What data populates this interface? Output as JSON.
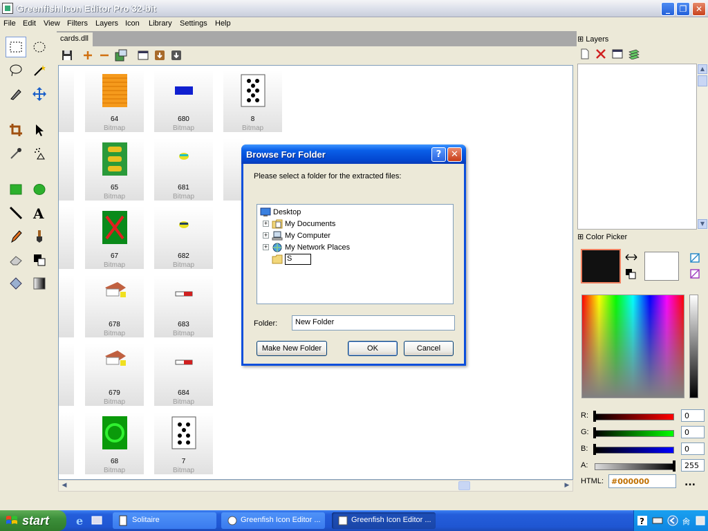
{
  "window": {
    "title": "Greenfish Icon Editor Pro 32-bit"
  },
  "menu": [
    "File",
    "Edit",
    "View",
    "Filters",
    "Layers",
    "Icon",
    "Library",
    "Settings",
    "Help"
  ],
  "document": {
    "tab_label": "cards.dll"
  },
  "icons": {
    "col1": [
      {
        "id": "64",
        "type": "Bitmap"
      },
      {
        "id": "65",
        "type": "Bitmap"
      },
      {
        "id": "67",
        "type": "Bitmap"
      },
      {
        "id": "678",
        "type": "Bitmap"
      },
      {
        "id": "679",
        "type": "Bitmap"
      },
      {
        "id": "68",
        "type": "Bitmap"
      }
    ],
    "col2": [
      {
        "id": "680",
        "type": "Bitmap"
      },
      {
        "id": "681",
        "type": "Bitmap"
      },
      {
        "id": "682",
        "type": "Bitmap"
      },
      {
        "id": "683",
        "type": "Bitmap"
      },
      {
        "id": "684",
        "type": "Bitmap"
      },
      {
        "id": "7",
        "type": "Bitmap"
      }
    ],
    "col3": [
      {
        "id": "8",
        "type": "Bitmap"
      }
    ]
  },
  "panels": {
    "layers_title": "Layers",
    "color_picker_title": "Color Picker",
    "r_label": "R:",
    "g_label": "G:",
    "b_label": "B:",
    "a_label": "A:",
    "r_value": "0",
    "g_value": "0",
    "b_value": "0",
    "a_value": "255",
    "html_label": "HTML:",
    "html_value": "#000000",
    "more": "..."
  },
  "dialog": {
    "title": "Browse For Folder",
    "prompt": "Please select a folder for the extracted files:",
    "tree": {
      "root": "Desktop",
      "items": [
        "My Documents",
        "My Computer",
        "My Network Places"
      ],
      "rename_value": "S"
    },
    "folder_label": "Folder:",
    "folder_value": "New Folder",
    "make_new_folder": "Make New Folder",
    "ok": "OK",
    "cancel": "Cancel"
  },
  "taskbar": {
    "start": "start",
    "items": [
      "Solitaire",
      "Greenfish Icon Editor ...",
      "Greenfish Icon Editor ..."
    ],
    "lang": "肏"
  }
}
